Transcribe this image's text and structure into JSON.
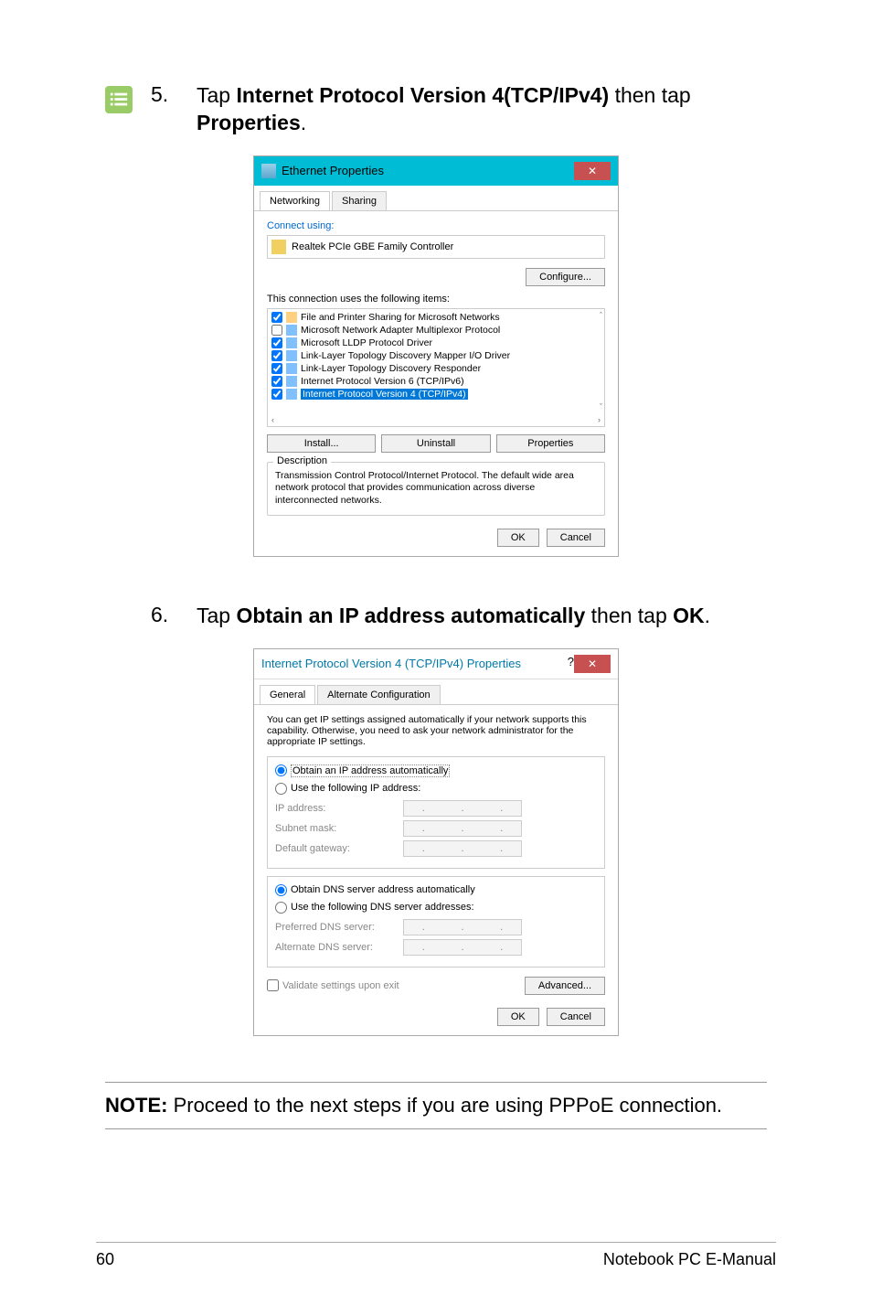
{
  "step5": {
    "icon_placeholder": "list-icon",
    "num": "5.",
    "prefix": "Tap ",
    "bold1": "Internet Protocol Version 4(TCP/IPv4)",
    "mid": " then tap ",
    "bold2": "Properties",
    "suffix": "."
  },
  "dialog1": {
    "title": "Ethernet Properties",
    "close": "✕",
    "tabs": {
      "networking": "Networking",
      "sharing": "Sharing"
    },
    "connect_using": "Connect using:",
    "device": "Realtek PCIe GBE Family Controller",
    "configure": "Configure...",
    "conn_uses": "This connection uses the following items:",
    "items": [
      {
        "name": "File and Printer Sharing for Microsoft Networks",
        "checked": true,
        "icon": "share"
      },
      {
        "name": "Microsoft Network Adapter Multiplexor Protocol",
        "checked": false,
        "icon": "proto"
      },
      {
        "name": "Microsoft LLDP Protocol Driver",
        "checked": true,
        "icon": "proto"
      },
      {
        "name": "Link-Layer Topology Discovery Mapper I/O Driver",
        "checked": true,
        "icon": "proto"
      },
      {
        "name": "Link-Layer Topology Discovery Responder",
        "checked": true,
        "icon": "proto"
      },
      {
        "name": "Internet Protocol Version 6 (TCP/IPv6)",
        "checked": true,
        "icon": "proto"
      },
      {
        "name": "Internet Protocol Version 4 (TCP/IPv4)",
        "checked": true,
        "icon": "proto",
        "selected": true
      }
    ],
    "install": "Install...",
    "uninstall": "Uninstall",
    "properties": "Properties",
    "desc_label": "Description",
    "desc_text": "Transmission Control Protocol/Internet Protocol. The default wide area network protocol that provides communication across diverse interconnected networks.",
    "ok": "OK",
    "cancel": "Cancel"
  },
  "step6": {
    "num": "6.",
    "prefix": "Tap ",
    "bold1": "Obtain an IP address automatically",
    "mid": " then tap ",
    "bold2": "OK",
    "suffix": "."
  },
  "dialog2": {
    "title": "Internet Protocol Version 4 (TCP/IPv4) Properties",
    "qmark": "?",
    "close": "✕",
    "tabs": {
      "general": "General",
      "alt": "Alternate Configuration"
    },
    "info": "You can get IP settings assigned automatically if your network supports this capability. Otherwise, you need to ask your network administrator for the appropriate IP settings.",
    "obtain_ip": "Obtain an IP address automatically",
    "use_following_ip": "Use the following IP address:",
    "ip_address": "IP address:",
    "subnet": "Subnet mask:",
    "gateway": "Default gateway:",
    "obtain_dns": "Obtain DNS server address automatically",
    "use_following_dns": "Use the following DNS server addresses:",
    "pref_dns": "Preferred DNS server:",
    "alt_dns": "Alternate DNS server:",
    "validate": "Validate settings upon exit",
    "advanced": "Advanced...",
    "ok": "OK",
    "cancel": "Cancel"
  },
  "note": {
    "label": "NOTE:",
    "text": " Proceed to the next steps if you are using PPPoE connection."
  },
  "footer": {
    "page": "60",
    "manual": "Notebook PC E-Manual"
  }
}
